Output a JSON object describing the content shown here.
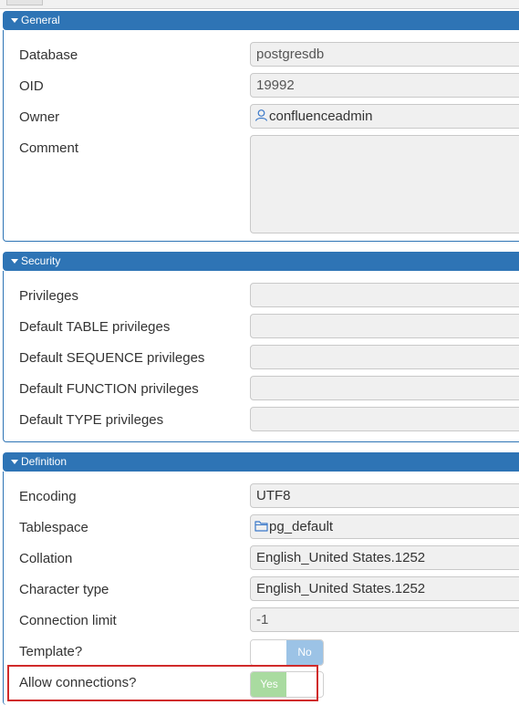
{
  "sections": {
    "general": {
      "title": "General",
      "database_label": "Database",
      "database_value": "postgresdb",
      "oid_label": "OID",
      "oid_value": "19992",
      "owner_label": "Owner",
      "owner_value": "confluenceadmin",
      "owner_icon": "user-icon",
      "comment_label": "Comment",
      "comment_value": ""
    },
    "security": {
      "title": "Security",
      "privileges_label": "Privileges",
      "default_table_label": "Default TABLE privileges",
      "default_sequence_label": "Default SEQUENCE privileges",
      "default_function_label": "Default FUNCTION privileges",
      "default_type_label": "Default TYPE privileges"
    },
    "definition": {
      "title": "Definition",
      "encoding_label": "Encoding",
      "encoding_value": "UTF8",
      "tablespace_label": "Tablespace",
      "tablespace_value": "pg_default",
      "tablespace_icon": "folder-icon",
      "collation_label": "Collation",
      "collation_value": "English_United States.1252",
      "ctype_label": "Character type",
      "ctype_value": "English_United States.1252",
      "connlimit_label": "Connection limit",
      "connlimit_value": "-1",
      "template_label": "Template?",
      "template_toggle_text": "No",
      "allow_conn_label": "Allow connections?",
      "allow_conn_toggle_text": "Yes"
    }
  },
  "colors": {
    "header_blue": "#2e74b5",
    "toggle_yes": "#a9dba0",
    "toggle_no": "#9cc3e6",
    "highlight_red": "#d02a2a"
  }
}
